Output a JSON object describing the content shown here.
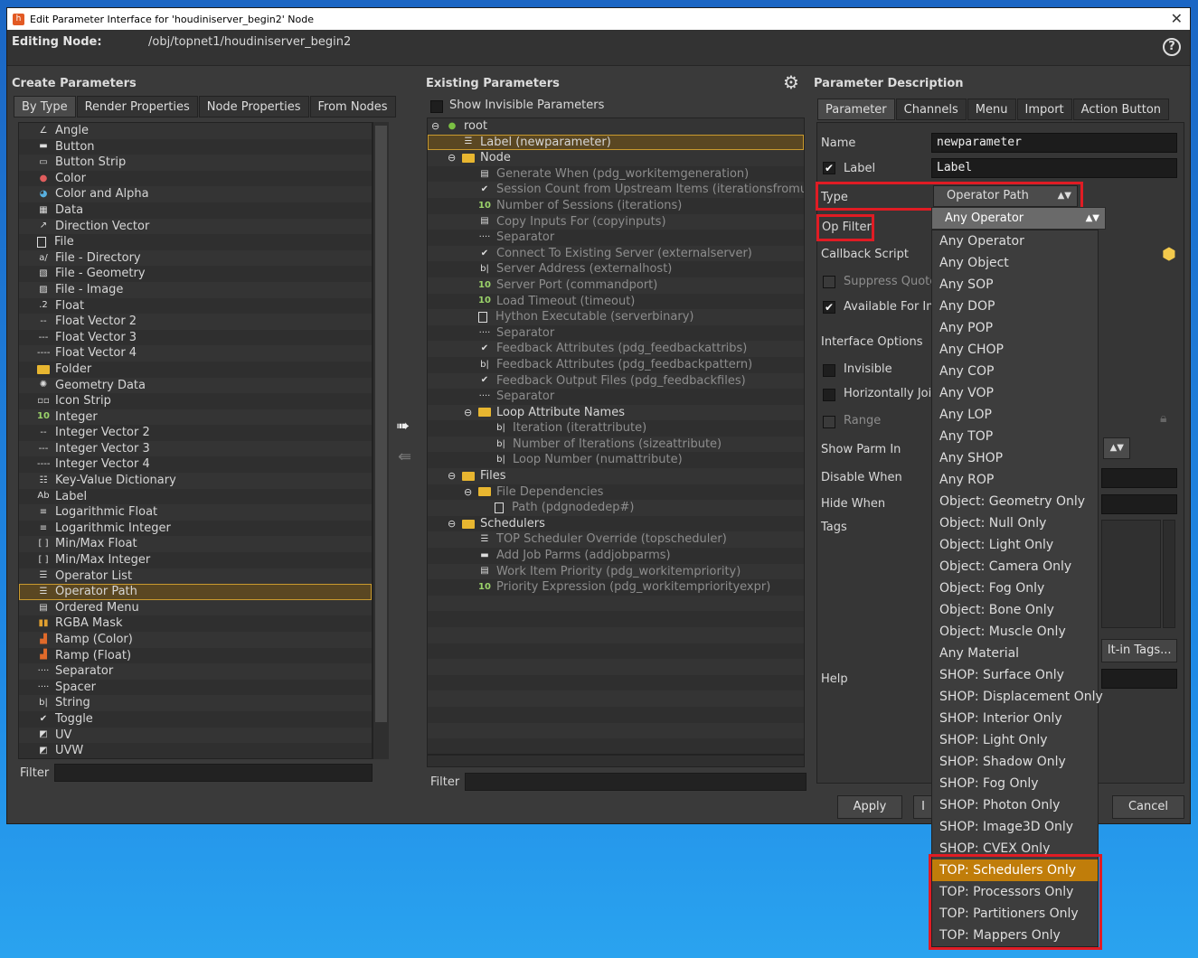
{
  "window": {
    "title": "Edit Parameter Interface for 'houdiniserver_begin2' Node",
    "close": "✕"
  },
  "editing": {
    "label": "Editing Node:",
    "path": "/obj/topnet1/houdiniserver_begin2",
    "help": "?"
  },
  "create": {
    "title": "Create Parameters",
    "tabs": [
      "By Type",
      "Render Properties",
      "Node Properties",
      "From Nodes"
    ],
    "items": [
      {
        "label": "Angle",
        "icon": "angle-icon",
        "glyph": "∠"
      },
      {
        "label": "Button",
        "icon": "button-icon",
        "glyph": "▬"
      },
      {
        "label": "Button Strip",
        "icon": "button-strip-icon",
        "glyph": "▭"
      },
      {
        "label": "Color",
        "icon": "color-icon",
        "glyph": "●"
      },
      {
        "label": "Color and Alpha",
        "icon": "color-alpha-icon",
        "glyph": "◕"
      },
      {
        "label": "Data",
        "icon": "data-icon",
        "glyph": "▦"
      },
      {
        "label": "Direction Vector",
        "icon": "direction-icon",
        "glyph": "↗"
      },
      {
        "label": "File",
        "icon": "file-icon",
        "glyph": "▯"
      },
      {
        "label": "File - Directory",
        "icon": "file-directory-icon",
        "glyph": "a/"
      },
      {
        "label": "File - Geometry",
        "icon": "file-geometry-icon",
        "glyph": "▧"
      },
      {
        "label": "File - Image",
        "icon": "file-image-icon",
        "glyph": "▨"
      },
      {
        "label": "Float",
        "icon": "float-icon",
        "glyph": ".2"
      },
      {
        "label": "Float Vector 2",
        "icon": "float-vector2-icon",
        "glyph": "--"
      },
      {
        "label": "Float Vector 3",
        "icon": "float-vector3-icon",
        "glyph": "---"
      },
      {
        "label": "Float Vector 4",
        "icon": "float-vector4-icon",
        "glyph": "----"
      },
      {
        "label": "Folder",
        "icon": "folder-icon",
        "glyph": ""
      },
      {
        "label": "Geometry Data",
        "icon": "geometry-data-icon",
        "glyph": "✺"
      },
      {
        "label": "Icon Strip",
        "icon": "icon-strip-icon",
        "glyph": "▫▫"
      },
      {
        "label": "Integer",
        "icon": "integer-icon",
        "glyph": "10"
      },
      {
        "label": "Integer Vector 2",
        "icon": "integer-vector2-icon",
        "glyph": "--"
      },
      {
        "label": "Integer Vector 3",
        "icon": "integer-vector3-icon",
        "glyph": "---"
      },
      {
        "label": "Integer Vector 4",
        "icon": "integer-vector4-icon",
        "glyph": "----"
      },
      {
        "label": "Key-Value Dictionary",
        "icon": "key-value-icon",
        "glyph": "☷"
      },
      {
        "label": "Label",
        "icon": "label-icon",
        "glyph": "Ab"
      },
      {
        "label": "Logarithmic Float",
        "icon": "log-float-icon",
        "glyph": "≡"
      },
      {
        "label": "Logarithmic Integer",
        "icon": "log-integer-icon",
        "glyph": "≡"
      },
      {
        "label": "Min/Max Float",
        "icon": "minmax-float-icon",
        "glyph": "[ ]"
      },
      {
        "label": "Min/Max Integer",
        "icon": "minmax-integer-icon",
        "glyph": "[ ]"
      },
      {
        "label": "Operator List",
        "icon": "operator-list-icon",
        "glyph": "☰"
      },
      {
        "label": "Operator Path",
        "icon": "operator-path-icon",
        "glyph": "☰"
      },
      {
        "label": "Ordered Menu",
        "icon": "ordered-menu-icon",
        "glyph": "▤"
      },
      {
        "label": "RGBA Mask",
        "icon": "rgba-mask-icon",
        "glyph": "▮▮"
      },
      {
        "label": "Ramp (Color)",
        "icon": "ramp-color-icon",
        "glyph": "▟"
      },
      {
        "label": "Ramp (Float)",
        "icon": "ramp-float-icon",
        "glyph": "▟"
      },
      {
        "label": "Separator",
        "icon": "separator-icon",
        "glyph": "····"
      },
      {
        "label": "Spacer",
        "icon": "spacer-icon",
        "glyph": "····"
      },
      {
        "label": "String",
        "icon": "string-icon",
        "glyph": "b|"
      },
      {
        "label": "Toggle",
        "icon": "toggle-icon",
        "glyph": "✔"
      },
      {
        "label": "UV",
        "icon": "uv-icon",
        "glyph": "◩"
      },
      {
        "label": "UVW",
        "icon": "uvw-icon",
        "glyph": "◩"
      }
    ],
    "selected_index": 29,
    "filter_label": "Filter"
  },
  "existing": {
    "title": "Existing Parameters",
    "show_invisible": "Show Invisible Parameters",
    "filter_label": "Filter",
    "rows": [
      {
        "label": "root",
        "indent": 0,
        "icon": "globe-icon",
        "glyph": "●",
        "expander": "⊖",
        "dim": false
      },
      {
        "label": "Label (newparameter)",
        "indent": 1,
        "icon": "operator-path-icon",
        "glyph": "☰",
        "expander": "",
        "dim": false,
        "selected": true
      },
      {
        "label": "Node",
        "indent": 1,
        "icon": "folder-icon",
        "glyph": "",
        "expander": "⊖",
        "dim": false
      },
      {
        "label": "Generate When (pdg_workitemgeneration)",
        "indent": 2,
        "icon": "ordered-menu-icon",
        "glyph": "▤",
        "expander": "",
        "dim": true
      },
      {
        "label": "Session Count from Upstream Items (iterationsfromupstrea",
        "indent": 2,
        "icon": "toggle-icon",
        "glyph": "✔",
        "expander": "",
        "dim": true
      },
      {
        "label": "Number of Sessions (iterations)",
        "indent": 2,
        "icon": "integer-icon",
        "glyph": "10",
        "expander": "",
        "dim": true
      },
      {
        "label": "Copy Inputs For (copyinputs)",
        "indent": 2,
        "icon": "ordered-menu-icon",
        "glyph": "▤",
        "expander": "",
        "dim": true
      },
      {
        "label": "Separator",
        "indent": 2,
        "icon": "separator-icon",
        "glyph": "····",
        "expander": "",
        "dim": true
      },
      {
        "label": "Connect To Existing Server (externalserver)",
        "indent": 2,
        "icon": "toggle-icon",
        "glyph": "✔",
        "expander": "",
        "dim": true
      },
      {
        "label": "Server Address (externalhost)",
        "indent": 2,
        "icon": "string-icon",
        "glyph": "b|",
        "expander": "",
        "dim": true
      },
      {
        "label": "Server Port (commandport)",
        "indent": 2,
        "icon": "integer-icon",
        "glyph": "10",
        "expander": "",
        "dim": true
      },
      {
        "label": "Load Timeout (timeout)",
        "indent": 2,
        "icon": "integer-icon",
        "glyph": "10",
        "expander": "",
        "dim": true
      },
      {
        "label": "Hython Executable (serverbinary)",
        "indent": 2,
        "icon": "file-icon",
        "glyph": "▯",
        "expander": "",
        "dim": true
      },
      {
        "label": "Separator",
        "indent": 2,
        "icon": "separator-icon",
        "glyph": "····",
        "expander": "",
        "dim": true
      },
      {
        "label": "Feedback Attributes (pdg_feedbackattribs)",
        "indent": 2,
        "icon": "toggle-icon",
        "glyph": "✔",
        "expander": "",
        "dim": true
      },
      {
        "label": "Feedback Attributes (pdg_feedbackpattern)",
        "indent": 2,
        "icon": "string-icon",
        "glyph": "b|",
        "expander": "",
        "dim": true
      },
      {
        "label": "Feedback Output Files (pdg_feedbackfiles)",
        "indent": 2,
        "icon": "toggle-icon",
        "glyph": "✔",
        "expander": "",
        "dim": true
      },
      {
        "label": "Separator",
        "indent": 2,
        "icon": "separator-icon",
        "glyph": "····",
        "expander": "",
        "dim": true
      },
      {
        "label": "Loop Attribute Names",
        "indent": 2,
        "icon": "folder-icon",
        "glyph": "",
        "expander": "⊖",
        "dim": false
      },
      {
        "label": "Iteration (iterattribute)",
        "indent": 3,
        "icon": "string-icon",
        "glyph": "b|",
        "expander": "",
        "dim": true
      },
      {
        "label": "Number of Iterations (sizeattribute)",
        "indent": 3,
        "icon": "string-icon",
        "glyph": "b|",
        "expander": "",
        "dim": true
      },
      {
        "label": "Loop Number (numattribute)",
        "indent": 3,
        "icon": "string-icon",
        "glyph": "b|",
        "expander": "",
        "dim": true
      },
      {
        "label": "Files",
        "indent": 1,
        "icon": "folder-icon",
        "glyph": "",
        "expander": "⊖",
        "dim": false
      },
      {
        "label": "File Dependencies",
        "indent": 2,
        "icon": "folder-icon",
        "glyph": "",
        "expander": "⊖",
        "dim": true
      },
      {
        "label": "Path (pdgnodedep#)",
        "indent": 3,
        "icon": "file-icon",
        "glyph": "▯",
        "expander": "",
        "dim": true
      },
      {
        "label": "Schedulers",
        "indent": 1,
        "icon": "folder-icon",
        "glyph": "",
        "expander": "⊖",
        "dim": false
      },
      {
        "label": "TOP Scheduler Override (topscheduler)",
        "indent": 2,
        "icon": "operator-path-icon",
        "glyph": "☰",
        "expander": "",
        "dim": true
      },
      {
        "label": "Add Job Parms (addjobparms)",
        "indent": 2,
        "icon": "button-icon",
        "glyph": "▬",
        "expander": "",
        "dim": true
      },
      {
        "label": "Work Item Priority (pdg_workitempriority)",
        "indent": 2,
        "icon": "ordered-menu-icon",
        "glyph": "▤",
        "expander": "",
        "dim": true
      },
      {
        "label": "Priority Expression (pdg_workitempriorityexpr)",
        "indent": 2,
        "icon": "integer-icon",
        "glyph": "10",
        "expander": "",
        "dim": true
      }
    ]
  },
  "description": {
    "title": "Parameter Description",
    "tabs": [
      "Parameter",
      "Channels",
      "Menu",
      "Import",
      "Action Button"
    ],
    "name_label": "Name",
    "name_value": "newparameter",
    "label_label": "Label",
    "label_value": "Label",
    "type_label": "Type",
    "type_value": "Operator Path",
    "opfilter_label": "Op Filter",
    "opfilter_value": "Any Operator",
    "callback_label": "Callback Script",
    "suppress_label": "Suppress Quotes",
    "available_label": "Available For Imp",
    "interface_label": "Interface Options",
    "invisible_label": "Invisible",
    "horiz_label": "Horizontally Join",
    "range_label": "Range",
    "showparm_label": "Show Parm In",
    "disable_label": "Disable When",
    "hide_label": "Hide When",
    "tags_label": "Tags",
    "builtin_tags": "lt-in Tags...",
    "help_label": "Help"
  },
  "buttons": {
    "apply": "Apply",
    "partial": "I",
    "cancel": "Cancel"
  },
  "opfilter_options": [
    "Any Operator",
    "Any Object",
    "Any SOP",
    "Any DOP",
    "Any POP",
    "Any CHOP",
    "Any COP",
    "Any VOP",
    "Any LOP",
    "Any TOP",
    "Any SHOP",
    "Any ROP",
    "Object: Geometry Only",
    "Object: Null Only",
    "Object: Light Only",
    "Object: Camera Only",
    "Object: Fog Only",
    "Object: Bone Only",
    "Object: Muscle Only",
    "Any Material",
    "SHOP: Surface Only",
    "SHOP: Displacement Only",
    "SHOP: Interior Only",
    "SHOP: Light Only",
    "SHOP: Shadow Only",
    "SHOP: Fog Only",
    "SHOP: Photon Only",
    "SHOP: Image3D Only",
    "SHOP: CVEX Only",
    "TOP: Schedulers Only",
    "TOP: Processors Only",
    "TOP: Partitioners Only",
    "TOP: Mappers Only"
  ],
  "opfilter_highlight_index": 29,
  "colors": {
    "highlight": "#e01c24",
    "selection": "#c07d0a",
    "folder": "#e8b630"
  }
}
